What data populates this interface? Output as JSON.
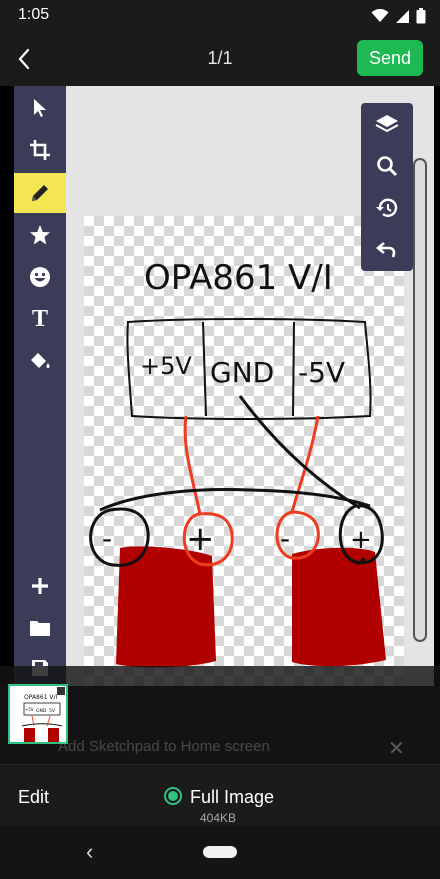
{
  "status_bar": {
    "time": "1:05",
    "icons": [
      "wifi-icon",
      "signal-icon",
      "battery-icon"
    ]
  },
  "header": {
    "page_indicator": "1/1",
    "send_label": "Send"
  },
  "toolbar_left": {
    "tools": [
      "select-icon",
      "crop-icon",
      "pencil-icon",
      "star-icon",
      "emoji-icon",
      "text-icon",
      "fill-bucket-icon",
      "add-icon",
      "folder-icon",
      "save-icon"
    ],
    "text_tool_label": "T",
    "active_tool": "pencil-icon"
  },
  "toolbar_right": {
    "tools": [
      "layers-icon",
      "zoom-icon",
      "history-icon",
      "undo-icon"
    ]
  },
  "drawing": {
    "title": "OPA861 V/I",
    "labels": [
      "+5V",
      "GND",
      "-5V"
    ],
    "terminals": [
      "-",
      "+",
      "-",
      "+"
    ]
  },
  "thumbnail": {
    "title": "OPA861 V/I",
    "labels": [
      "+5V",
      "GND",
      "5V"
    ]
  },
  "toast": {
    "text": "Add Sketchpad to Home screen",
    "close_icon": "close-icon"
  },
  "bottom": {
    "edit_label": "Edit",
    "full_image_label": "Full Image",
    "file_size": "404KB"
  },
  "colors": {
    "accent": "#1fb954",
    "toolbar": "#3b3d58",
    "active_tool": "#f4e552",
    "ink_red": "#ef3b1f",
    "fill_red": "#b00000"
  }
}
